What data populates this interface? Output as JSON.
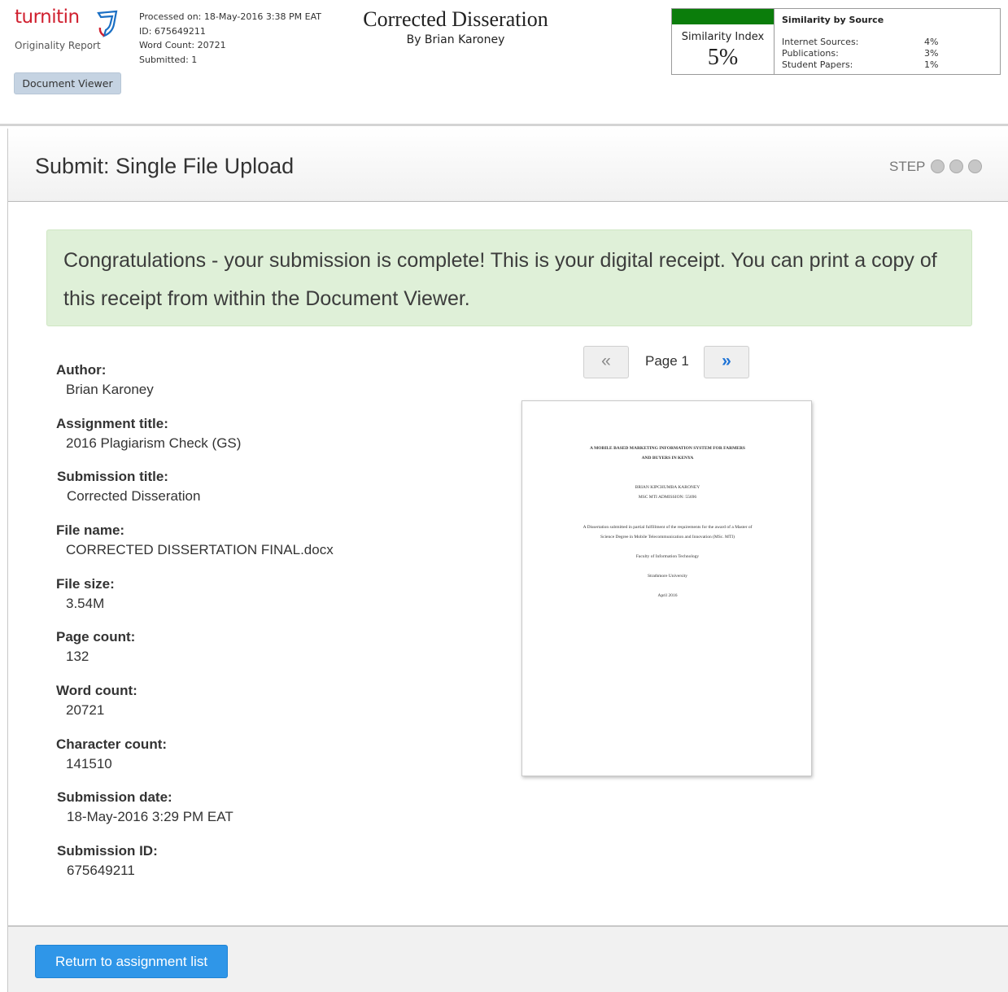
{
  "report": {
    "logo_text": "turnitin",
    "logo_subtitle": "Originality Report",
    "processed_on": "Processed on: 18-May-2016 3:38 PM EAT",
    "id": "ID: 675649211",
    "word_count": "Word Count: 20721",
    "submitted": "Submitted: 1",
    "document_title": "Corrected Disseration",
    "document_author": "By Brian Karoney",
    "document_viewer_button": "Document Viewer",
    "similarity": {
      "bar_color": "#0b7d0b",
      "index_label": "Similarity Index",
      "index_value": "5%",
      "by_source_title": "Similarity by Source",
      "sources": [
        {
          "label": "Internet Sources:",
          "value": "4%"
        },
        {
          "label": "Publications:",
          "value": "3%"
        },
        {
          "label": "Student Papers:",
          "value": "1%"
        }
      ]
    }
  },
  "panel": {
    "title": "Submit: Single File Upload",
    "step_label": "STEP",
    "success_message": "Congratulations - your submission is complete! This is your digital receipt. You can print a copy of this receipt from within the Document Viewer.",
    "fields": [
      {
        "label": "Author:",
        "value": "Brian Karoney"
      },
      {
        "label": "Assignment title:",
        "value": "2016 Plagiarism Check (GS)"
      },
      {
        "label": "Submission title:",
        "value": "Corrected Disseration"
      },
      {
        "label": "File name:",
        "value": "CORRECTED DISSERTATION FINAL.docx"
      },
      {
        "label": "File size:",
        "value": "3.54M"
      },
      {
        "label": "Page count:",
        "value": "132"
      },
      {
        "label": "Word count:",
        "value": "20721"
      },
      {
        "label": "Character count:",
        "value": "141510"
      },
      {
        "label": "Submission date:",
        "value": "18-May-2016 3:29 PM EAT"
      },
      {
        "label": "Submission ID:",
        "value": "675649211"
      }
    ],
    "pager": {
      "prev_icon": "«",
      "next_icon": "»",
      "page_label": "Page 1"
    },
    "preview": {
      "title_line1": "A MOBILE BASED MARKETING INFORMATION SYSTEM FOR FARMERS",
      "title_line2": "AND BUYERS IN KENYA",
      "author_line": "BRIAN KIPCHUMBA KARONEY",
      "admission_line": "MSC MTI ADMISSION: 55696",
      "desc_line1": "A Dissertation submitted in partial fulfillment of the requirements for the award of a Master of",
      "desc_line2": "Science Degree in Mobile Telecommunication and Innovation (MSc. MTI)",
      "faculty_line": "Faculty of Information Technology",
      "university_line": "Strathmore University",
      "date_line": "April 2016"
    },
    "return_button": "Return to assignment list"
  }
}
